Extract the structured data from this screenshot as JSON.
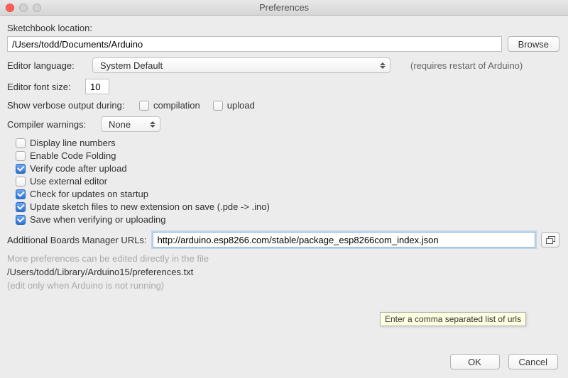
{
  "window": {
    "title": "Preferences"
  },
  "sketchbook": {
    "label": "Sketchbook location:",
    "path": "/Users/todd/Documents/Arduino",
    "browse": "Browse"
  },
  "language": {
    "label": "Editor language:",
    "value": "System Default",
    "hint": "(requires restart of Arduino)"
  },
  "fontsize": {
    "label": "Editor font size:",
    "value": "10"
  },
  "verbose": {
    "label": "Show verbose output during:",
    "compilation": {
      "label": "compilation",
      "checked": false
    },
    "upload": {
      "label": "upload",
      "checked": false
    }
  },
  "warnings": {
    "label": "Compiler warnings:",
    "value": "None"
  },
  "opts": {
    "display_line_numbers": {
      "label": "Display line numbers",
      "checked": false
    },
    "code_folding": {
      "label": "Enable Code Folding",
      "checked": false
    },
    "verify_upload": {
      "label": "Verify code after upload",
      "checked": true
    },
    "external_editor": {
      "label": "Use external editor",
      "checked": false
    },
    "check_updates": {
      "label": "Check for updates on startup",
      "checked": true
    },
    "update_ext": {
      "label": "Update sketch files to new extension on save (.pde -> .ino)",
      "checked": true
    },
    "save_verify": {
      "label": "Save when verifying or uploading",
      "checked": true
    }
  },
  "urls": {
    "label": "Additional Boards Manager URLs:",
    "value": "http://arduino.esp8266.com/stable/package_esp8266com_index.json",
    "tooltip": "Enter a comma separated list of urls"
  },
  "more": {
    "line1": "More preferences can be edited directly in the file",
    "path": "/Users/todd/Library/Arduino15/preferences.txt",
    "line3": "(edit only when Arduino is not running)"
  },
  "buttons": {
    "ok": "OK",
    "cancel": "Cancel"
  }
}
